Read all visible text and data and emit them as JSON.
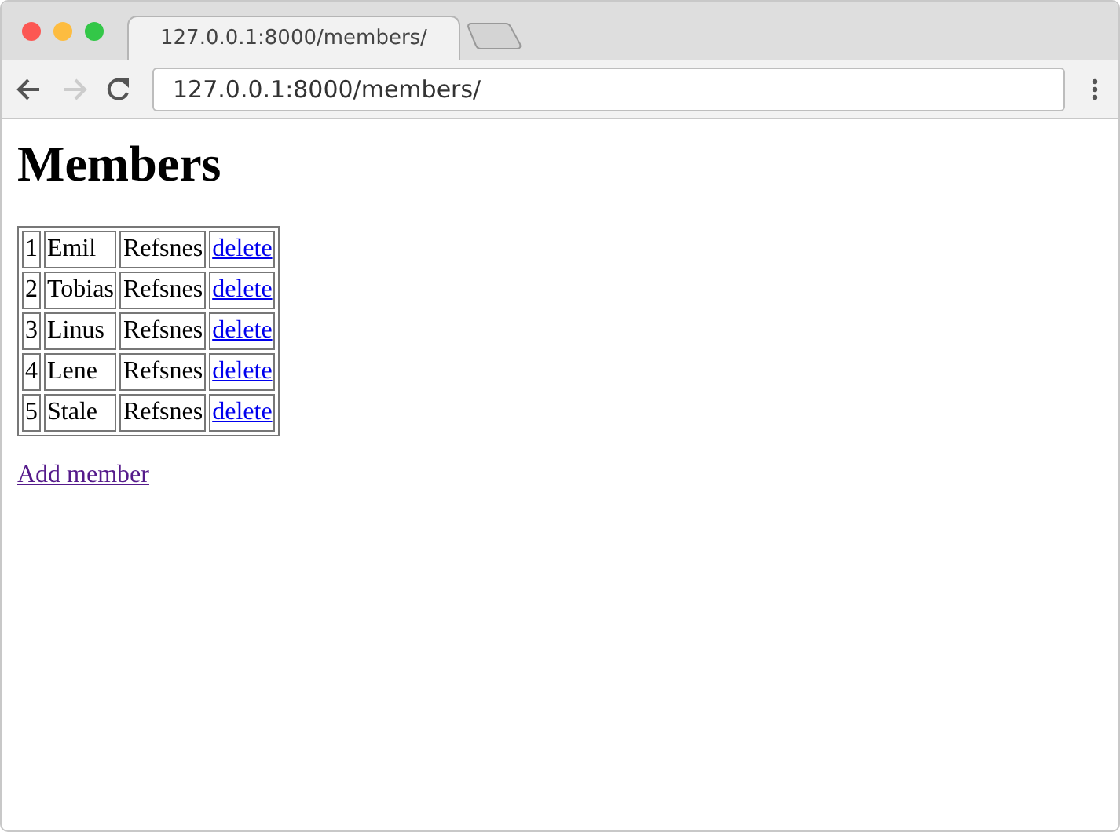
{
  "tab": {
    "title": "127.0.0.1:8000/members/"
  },
  "address_bar": {
    "url": "127.0.0.1:8000/members/"
  },
  "heading": "Members",
  "table": {
    "rows": [
      {
        "column_1": "1",
        "column_2": "Emil",
        "column_3": "Refsnes",
        "link": "delete"
      },
      {
        "column_1": "2",
        "column_2": "Tobias",
        "column_3": "Refsnes",
        "link": "delete"
      },
      {
        "column_1": "3",
        "column_2": "Linus",
        "column_3": "Refsnes",
        "link": "delete"
      },
      {
        "column_1": "4",
        "column_2": "Lene",
        "column_3": "Refsnes",
        "link": "delete"
      },
      {
        "column_1": "5",
        "column_2": "Stale",
        "column_3": "Refsnes",
        "link": "delete"
      }
    ]
  },
  "add_link": "Add member"
}
